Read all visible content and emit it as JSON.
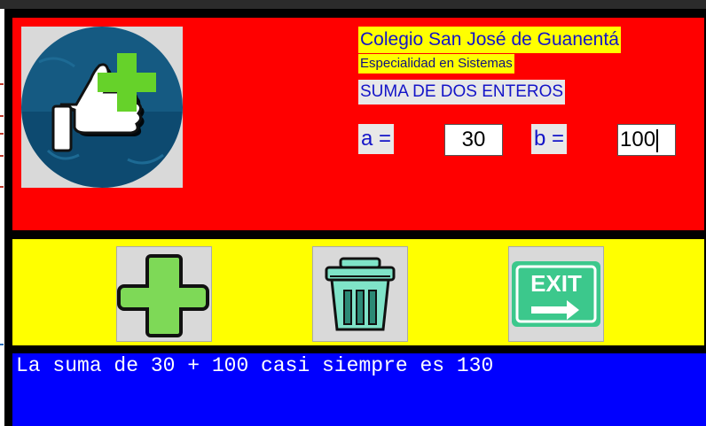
{
  "header": {
    "school": "Colegio San José de Guanentá",
    "specialty": "Especialidad en Sistemas",
    "title": "SUMA DE DOS ENTEROS"
  },
  "inputs": {
    "a_label": "a =",
    "a_value": "30",
    "b_label": "b =",
    "b_value": "100"
  },
  "toolbar": {
    "add_icon": "plus-icon",
    "clear_icon": "trash-icon",
    "exit_icon": "exit-sign-icon",
    "exit_text": "EXIT"
  },
  "output": {
    "result_text": "La suma de 30 + 100 casi siempre es 130"
  },
  "colors": {
    "top_panel": "#ff0000",
    "button_panel": "#ffff00",
    "output_panel": "#0000ff",
    "label_text": "#1414c8",
    "plus_green": "#7ed957",
    "trash_teal": "#7fe3c8",
    "exit_green": "#3cc88c"
  }
}
